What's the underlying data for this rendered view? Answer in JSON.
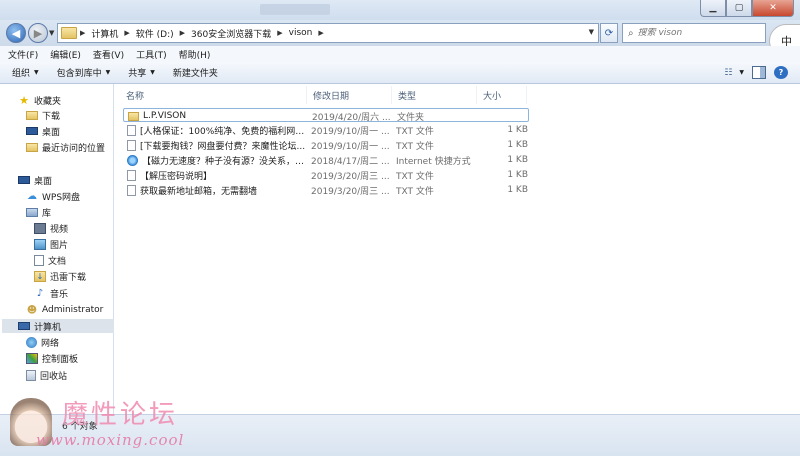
{
  "address": {
    "breadcrumbs": [
      "计算机",
      "软件 (D:)",
      "360安全浏览器下载",
      "vison"
    ],
    "search_placeholder": "搜索 vison",
    "ime_char": "中"
  },
  "menu": [
    "文件(F)",
    "编辑(E)",
    "查看(V)",
    "工具(T)",
    "帮助(H)"
  ],
  "toolbar": {
    "organize": "组织",
    "include_library": "包含到库中",
    "share": "共享",
    "new_folder": "新建文件夹"
  },
  "sidebar": {
    "favorites": "收藏夹",
    "downloads": "下载",
    "desktop_fav": "桌面",
    "recent": "最近访问的位置",
    "desktop": "桌面",
    "wps": "WPS网盘",
    "library": "库",
    "videos": "视频",
    "pictures": "图片",
    "documents": "文档",
    "thunder": "迅雷下载",
    "music": "音乐",
    "admin": "Administrator",
    "computer": "计算机",
    "network": "网络",
    "control_panel": "控制面板",
    "recycle": "回收站"
  },
  "columns": {
    "name": "名称",
    "date": "修改日期",
    "type": "类型",
    "size": "大小"
  },
  "files": [
    {
      "name": "L.P.VISON",
      "date": "2019/4/20/周六 ...",
      "type": "文件夹",
      "size": "",
      "icon": "folder-icon"
    },
    {
      "name": "[人格保证：100%纯净、免费的福利网站...",
      "date": "2019/9/10/周一 ...",
      "type": "TXT 文件",
      "size": "1 KB",
      "icon": "text-file-icon"
    },
    {
      "name": "[下载要掏钱？网盘要付费？来魔性论坛...",
      "date": "2019/9/10/周一 ...",
      "type": "TXT 文件",
      "size": "1 KB",
      "icon": "text-file-icon"
    },
    {
      "name": "【磁力无速度？种子没有源？没关系，来...",
      "date": "2018/4/17/周二 ...",
      "type": "Internet 快捷方式",
      "size": "1 KB",
      "icon": "internet-shortcut-icon"
    },
    {
      "name": "【解压密码说明】",
      "date": "2019/3/20/周三 ...",
      "type": "TXT 文件",
      "size": "1 KB",
      "icon": "text-file-icon"
    },
    {
      "name": "获取最新地址邮箱，无需翻墙",
      "date": "2019/3/20/周三 ...",
      "type": "TXT 文件",
      "size": "1 KB",
      "icon": "text-file-icon"
    }
  ],
  "status": {
    "count": "6 个对象"
  },
  "watermark": {
    "title": "魔性论坛",
    "url": "www.moxing.cool"
  }
}
